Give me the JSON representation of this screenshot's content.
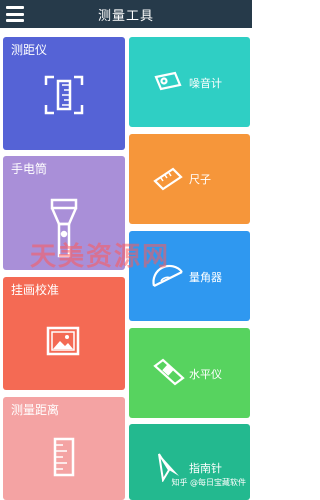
{
  "appbar": {
    "title": "测量工具",
    "menu_icon": "hamburger-menu-icon"
  },
  "tiles": {
    "rangefinder": {
      "label": "测距仪",
      "icon": "rangefinder-icon",
      "color": "#5563d6"
    },
    "flashlight": {
      "label": "手电筒",
      "icon": "flashlight-icon",
      "color": "#a98fd8"
    },
    "hanging": {
      "label": "挂画校准",
      "icon": "picture-frame-icon",
      "color": "#f46a54"
    },
    "distance": {
      "label": "测量距离",
      "icon": "ruler-vertical-icon",
      "color": "#f4a3a3"
    },
    "noise": {
      "label": "噪音计",
      "icon": "noise-meter-icon",
      "color": "#2fcfc4"
    },
    "ruler": {
      "label": "尺子",
      "icon": "ruler-icon",
      "color": "#f6963a"
    },
    "protractor": {
      "label": "量角器",
      "icon": "protractor-icon",
      "color": "#2f98f0"
    },
    "level": {
      "label": "水平仪",
      "icon": "spirit-level-icon",
      "color": "#57d35f"
    },
    "compass": {
      "label": "指南针",
      "icon": "compass-icon",
      "color": "#23b98f"
    }
  },
  "overlay": {
    "watermark": "天美资源网",
    "credit": "知乎 @每日宝藏软件"
  }
}
